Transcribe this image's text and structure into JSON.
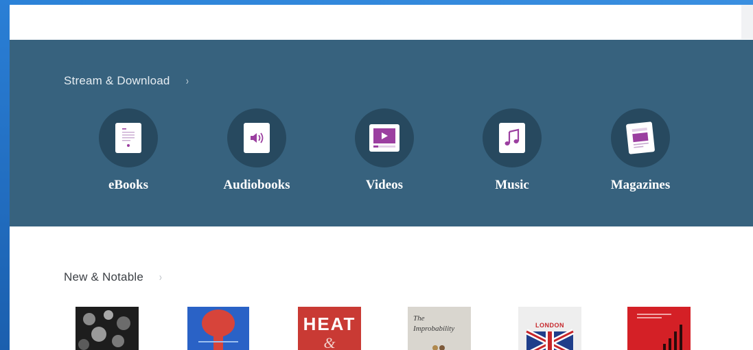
{
  "stream": {
    "title": "Stream & Download",
    "chevron": "›",
    "categories": [
      {
        "label": "eBooks",
        "icon": "ebook-icon"
      },
      {
        "label": "Audiobooks",
        "icon": "audiobook-icon"
      },
      {
        "label": "Videos",
        "icon": "video-icon"
      },
      {
        "label": "Music",
        "icon": "music-icon"
      },
      {
        "label": "Magazines",
        "icon": "magazine-icon"
      }
    ]
  },
  "notable": {
    "title": "New & Notable",
    "chevron": "›",
    "covers": [
      {
        "name": "cover-1",
        "text": ""
      },
      {
        "name": "cover-2",
        "text": ""
      },
      {
        "name": "cover-3",
        "text": "HEAT"
      },
      {
        "name": "cover-4",
        "text": "The Improbability"
      },
      {
        "name": "cover-5",
        "text": "LONDON"
      },
      {
        "name": "cover-6",
        "text": ""
      }
    ]
  },
  "colors": {
    "banner": "#37627e",
    "icon_circle": "#27495f",
    "accent_purple": "#9b3fa0",
    "page_bg": "#ffffff"
  }
}
